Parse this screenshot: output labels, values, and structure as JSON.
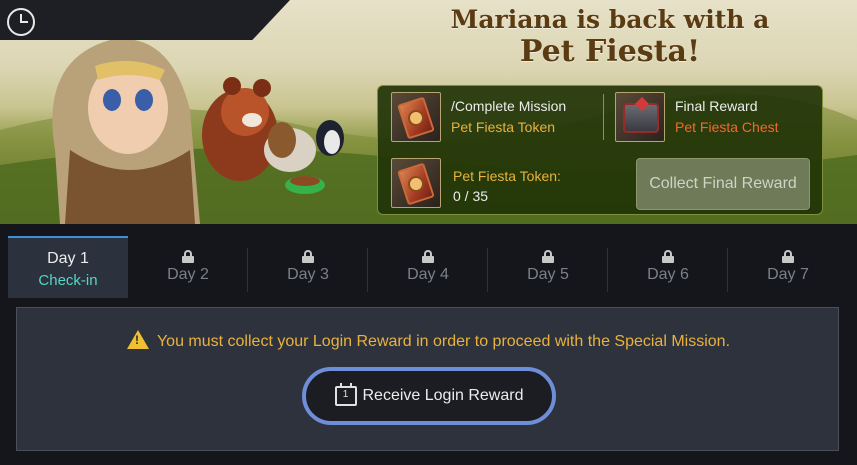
{
  "banner": {
    "title_line1": "Mariana is back with a",
    "title_line2": "Pet Fiesta!"
  },
  "mission": {
    "task_label": "/Complete Mission",
    "task_reward": "Pet Fiesta Token",
    "final_label": "Final Reward",
    "final_reward": "Pet Fiesta Chest",
    "token_label": "Pet Fiesta Token:",
    "token_progress": "0 / 35",
    "token_current": 0,
    "token_total": 35,
    "collect_button": "Collect Final Reward"
  },
  "tabs": [
    {
      "label": "Day 1",
      "sub": "Check-in",
      "locked": false,
      "active": true
    },
    {
      "label": "Day 2",
      "locked": true
    },
    {
      "label": "Day 3",
      "locked": true
    },
    {
      "label": "Day 4",
      "locked": true
    },
    {
      "label": "Day 5",
      "locked": true
    },
    {
      "label": "Day 6",
      "locked": true
    },
    {
      "label": "Day 7",
      "locked": true
    }
  ],
  "content": {
    "notice": "You must collect your Login Reward in order to proceed with the Special Mission.",
    "receive_button": "Receive Login Reward",
    "calendar_day": "1"
  },
  "icons": [
    "clock-icon",
    "token-icon",
    "chest-icon",
    "lock-icon",
    "warning-icon",
    "calendar-icon"
  ],
  "colors": {
    "accent_gold": "#e9b23c",
    "accent_orange": "#f06a2a",
    "checkin_teal": "#58d4c4",
    "active_tab_border": "#3f8fd6",
    "button_ring": "#6e8fd8"
  }
}
